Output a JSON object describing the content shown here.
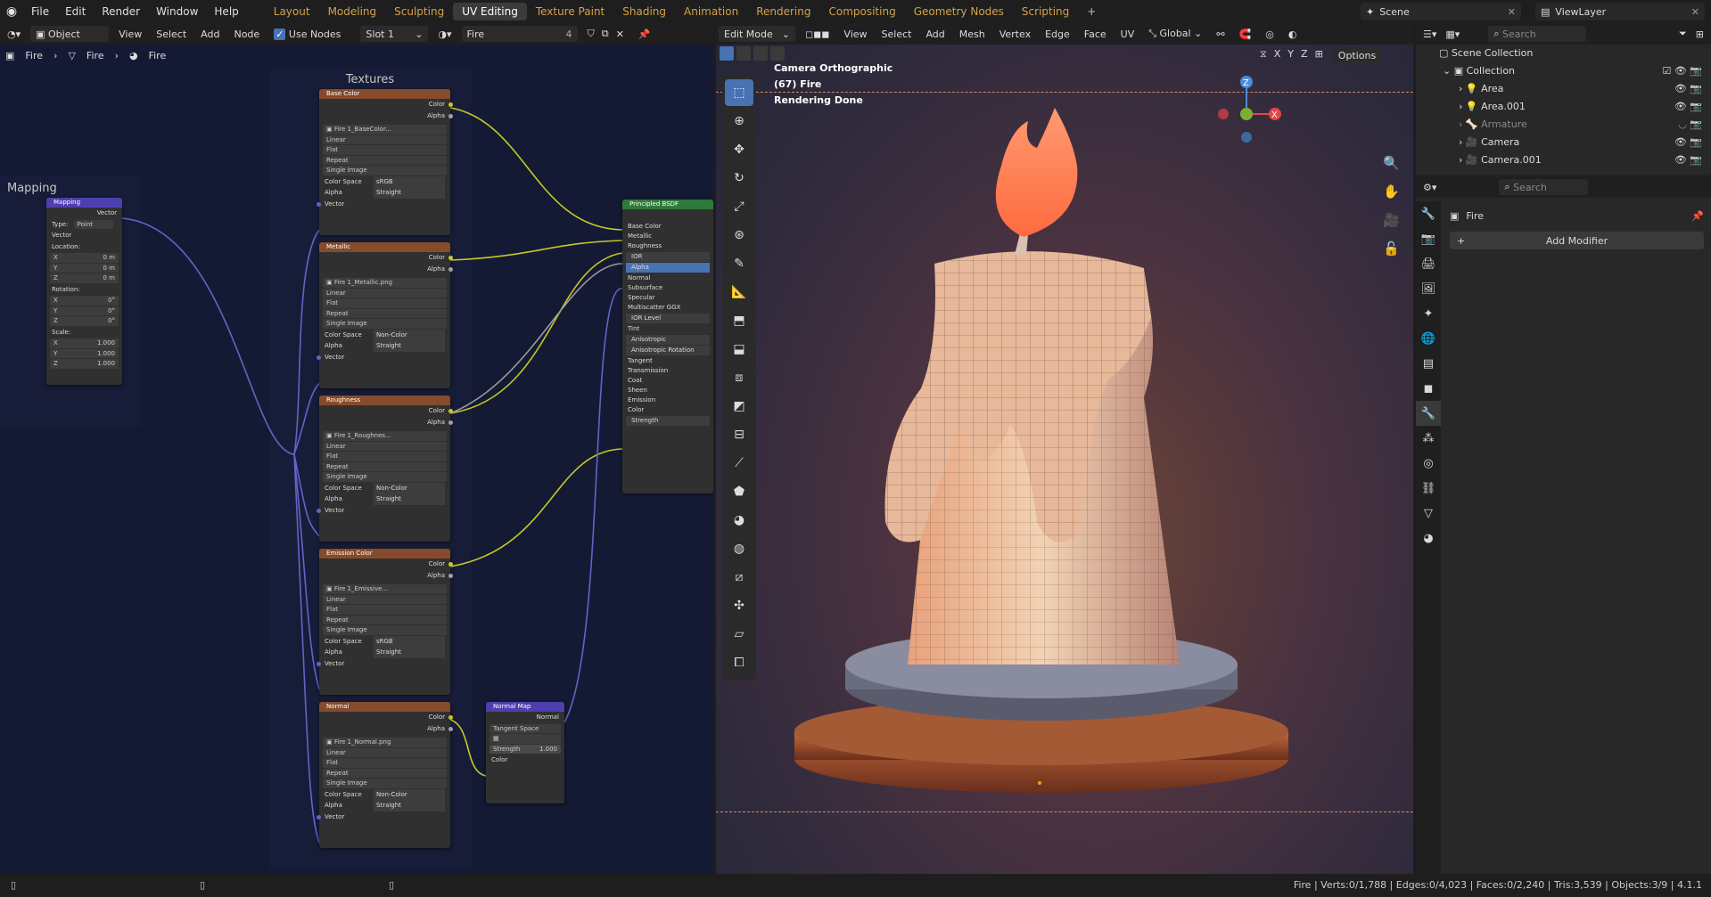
{
  "menu": {
    "file": "File",
    "edit": "Edit",
    "render": "Render",
    "window": "Window",
    "help": "Help"
  },
  "workspaces": [
    "Layout",
    "Modeling",
    "Sculpting",
    "UV Editing",
    "Texture Paint",
    "Shading",
    "Animation",
    "Rendering",
    "Compositing",
    "Geometry Nodes",
    "Scripting"
  ],
  "workspace_add": "+",
  "scene": {
    "label": "Scene",
    "viewlayer": "ViewLayer"
  },
  "node_editor": {
    "mode": "Object",
    "view": "View",
    "select": "Select",
    "add": "Add",
    "node": "Node",
    "use_nodes": "Use Nodes",
    "slot": "Slot 1",
    "material": "Fire",
    "users": "4",
    "breadcrumb": [
      "Fire",
      "Fire",
      "Fire"
    ],
    "frame_textures": "Textures",
    "frame_mapping": "Mapping",
    "mapping_node": {
      "title": "Mapping",
      "out": "Vector",
      "type_label": "Type:",
      "type_value": "Point",
      "vector": "Vector",
      "location": "Location:",
      "rotation": "Rotation:",
      "scale": "Scale:",
      "loc": [
        [
          "X",
          "0 m"
        ],
        [
          "Y",
          "0 m"
        ],
        [
          "Z",
          "0 m"
        ]
      ],
      "rot": [
        [
          "X",
          "0°"
        ],
        [
          "Y",
          "0°"
        ],
        [
          "Z",
          "0°"
        ]
      ],
      "scl": [
        [
          "X",
          "1.000"
        ],
        [
          "Y",
          "1.000"
        ],
        [
          "Z",
          "1.000"
        ]
      ]
    },
    "tex_nodes": [
      {
        "title": "Base Color",
        "file": "Fire 1_BaseColor...",
        "cs": "sRGB",
        "alpha": "Straight"
      },
      {
        "title": "Metallic",
        "file": "Fire 1_Metallic.png",
        "cs": "Non-Color",
        "alpha": "Straight"
      },
      {
        "title": "Roughness",
        "file": "Fire 1_Roughnes...",
        "cs": "Non-Color",
        "alpha": "Straight"
      },
      {
        "title": "Emission Color",
        "file": "Fire 1_Emissive...",
        "cs": "sRGB",
        "alpha": "Straight"
      },
      {
        "title": "Normal",
        "file": "Fire 1_Normal.png",
        "cs": "Non-Color",
        "alpha": "Straight"
      }
    ],
    "tex_common": {
      "color": "Color",
      "alpha": "Alpha",
      "linear": "Linear",
      "flat": "Flat",
      "repeat": "Repeat",
      "single": "Single Image",
      "cs_label": "Color Space",
      "alpha_label": "Alpha",
      "vector": "Vector"
    },
    "bsdf": {
      "title": "Principled BSDF",
      "rows": [
        "Base Color",
        "Metallic",
        "Roughness",
        "IOR",
        "Alpha",
        "Normal",
        "Subsurface",
        "Specular",
        "Multiscatter GGX",
        "IOR Level",
        "Tint",
        "Anisotropic",
        "Anisotropic Rotation",
        "Tangent",
        "Transmission",
        "Coat",
        "Sheen",
        "Emission",
        "Color",
        "Strength"
      ]
    },
    "normal_map": {
      "title": "Normal Map",
      "out": "Normal",
      "space": "Tangent Space",
      "strength_label": "Strength",
      "strength": "1.000",
      "color": "Color"
    }
  },
  "viewport": {
    "mode": "Edit Mode",
    "view": "View",
    "select": "Select",
    "add": "Add",
    "mesh": "Mesh",
    "vertex": "Vertex",
    "edge": "Edge",
    "face": "Face",
    "uv": "UV",
    "transform": "Global",
    "options": "Options",
    "axes": [
      "X",
      "Y",
      "Z"
    ],
    "info": [
      "Camera Orthographic",
      "(67) Fire",
      "Rendering Done"
    ],
    "gizmo": {
      "z": "Z",
      "x": "X"
    }
  },
  "outliner": {
    "search": "Search",
    "root": "Scene Collection",
    "collection": "Collection",
    "items": [
      "Area",
      "Area.001",
      "Armature",
      "Camera",
      "Camera.001"
    ]
  },
  "properties": {
    "search": "Search",
    "object": "Fire",
    "add_modifier": "Add Modifier"
  },
  "status": {
    "object": "Fire",
    "verts": "Verts:0/1,788",
    "edges": "Edges:0/4,023",
    "faces": "Faces:0/2,240",
    "tris": "Tris:3,539",
    "objects": "Objects:3/9",
    "version": "4.1.1"
  },
  "colors": {
    "accent": "#4772b3",
    "tex_header": "#864b2b",
    "bsdf_header": "#2e7a3a",
    "vector_header": "#4e3fb0",
    "color_socket": "#c7c729",
    "vector_socket": "#6363c7",
    "ws_text": "#d4a24a"
  }
}
